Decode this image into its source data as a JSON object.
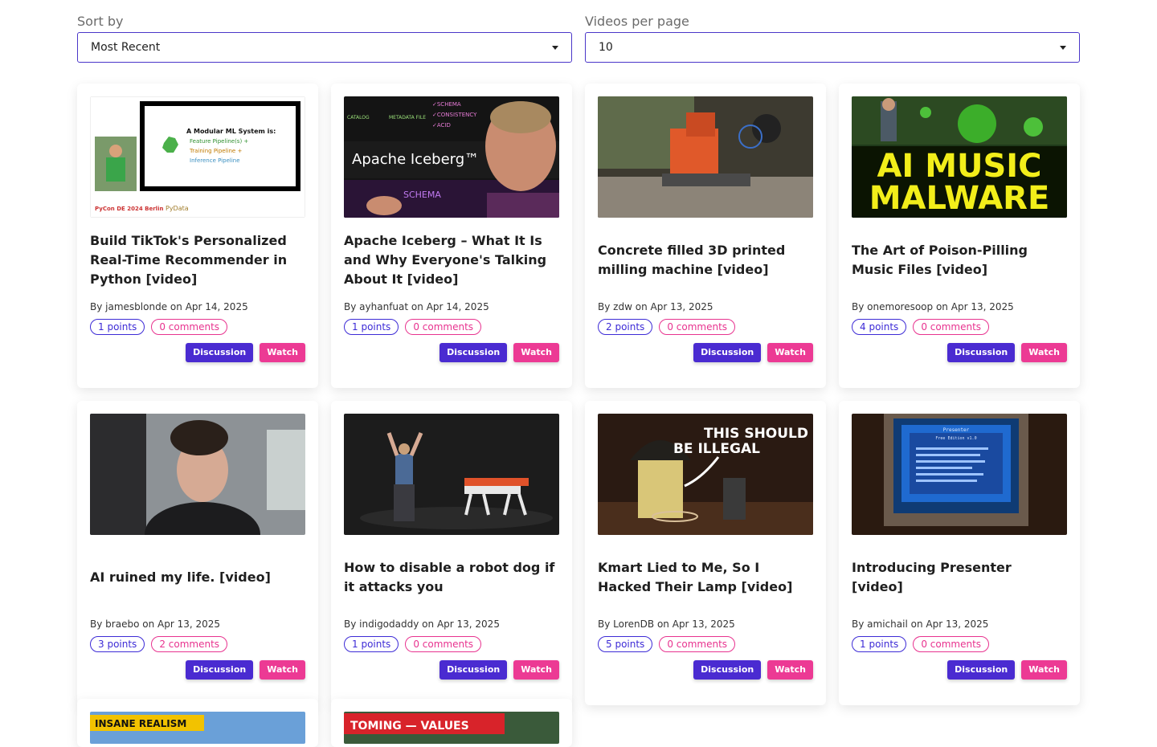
{
  "controls": {
    "sort_label": "Sort by",
    "sort_value": "Most Recent",
    "per_page_label": "Videos per page",
    "per_page_value": "10"
  },
  "buttons": {
    "discussion": "Discussion",
    "watch": "Watch"
  },
  "videos": [
    {
      "title": "Build TikTok's Personalized Real-Time Recommender in Python [video]",
      "by": "By",
      "author": "jamesblonde",
      "on": "on",
      "date": "Apr 14, 2025",
      "points": "1 points",
      "comments": "0 comments",
      "thumb_text": {
        "heading": "A Modular ML System is:",
        "items": [
          "Feature Pipeline(s) +",
          "Training Pipeline +",
          "Inference Pipeline"
        ],
        "logo1": "PyCon DE 2024 Berlin",
        "logo2": "PyData"
      }
    },
    {
      "title": "Apache Iceberg – What It Is and Why Everyone's Talking About It [video]",
      "by": "By",
      "author": "ayhanfuat",
      "on": "on",
      "date": "Apr 14, 2025",
      "points": "1 points",
      "comments": "0 comments",
      "thumb_text": {
        "heading": "Apache Iceberg™",
        "notes": [
          "✓SCHEMA",
          "✓CONSISTENCY",
          "✓ACID"
        ],
        "left": "CATALOG",
        "mid": "METADATA FILE",
        "bottom": "SCHEMA"
      }
    },
    {
      "title": "Concrete filled 3D printed milling machine [video]",
      "by": "By",
      "author": "zdw",
      "on": "on",
      "date": "Apr 13, 2025",
      "points": "2 points",
      "comments": "0 comments"
    },
    {
      "title": "The Art of Poison-Pilling Music Files [video]",
      "by": "By",
      "author": "onemoresoop",
      "on": "on",
      "date": "Apr 13, 2025",
      "points": "4 points",
      "comments": "0 comments",
      "thumb_text": {
        "line1": "AI MUSIC",
        "line2": "MALWARE"
      }
    },
    {
      "title": "AI ruined my life. [video]",
      "by": "By",
      "author": "braebo",
      "on": "on",
      "date": "Apr 13, 2025",
      "points": "3 points",
      "comments": "2 comments"
    },
    {
      "title": "How to disable a robot dog if it attacks you",
      "by": "By",
      "author": "indigodaddy",
      "on": "on",
      "date": "Apr 13, 2025",
      "points": "1 points",
      "comments": "0 comments"
    },
    {
      "title": "Kmart Lied to Me, So I Hacked Their Lamp [video]",
      "by": "By",
      "author": "LorenDB",
      "on": "on",
      "date": "Apr 13, 2025",
      "points": "5 points",
      "comments": "0 comments",
      "thumb_text": {
        "line1": "THIS SHOULD",
        "line2": "BE ILLEGAL"
      }
    },
    {
      "title": "Introducing Presenter [video]",
      "by": "By",
      "author": "amichail",
      "on": "on",
      "date": "Apr 13, 2025",
      "points": "1 points",
      "comments": "0 comments",
      "thumb_text": {
        "line1": "Presenter",
        "line2": "Free Edition v1.0"
      }
    }
  ],
  "partial_thumbs": [
    {
      "text": "INSANE REALISM"
    },
    {
      "text": "TOMING — VALUES"
    }
  ]
}
